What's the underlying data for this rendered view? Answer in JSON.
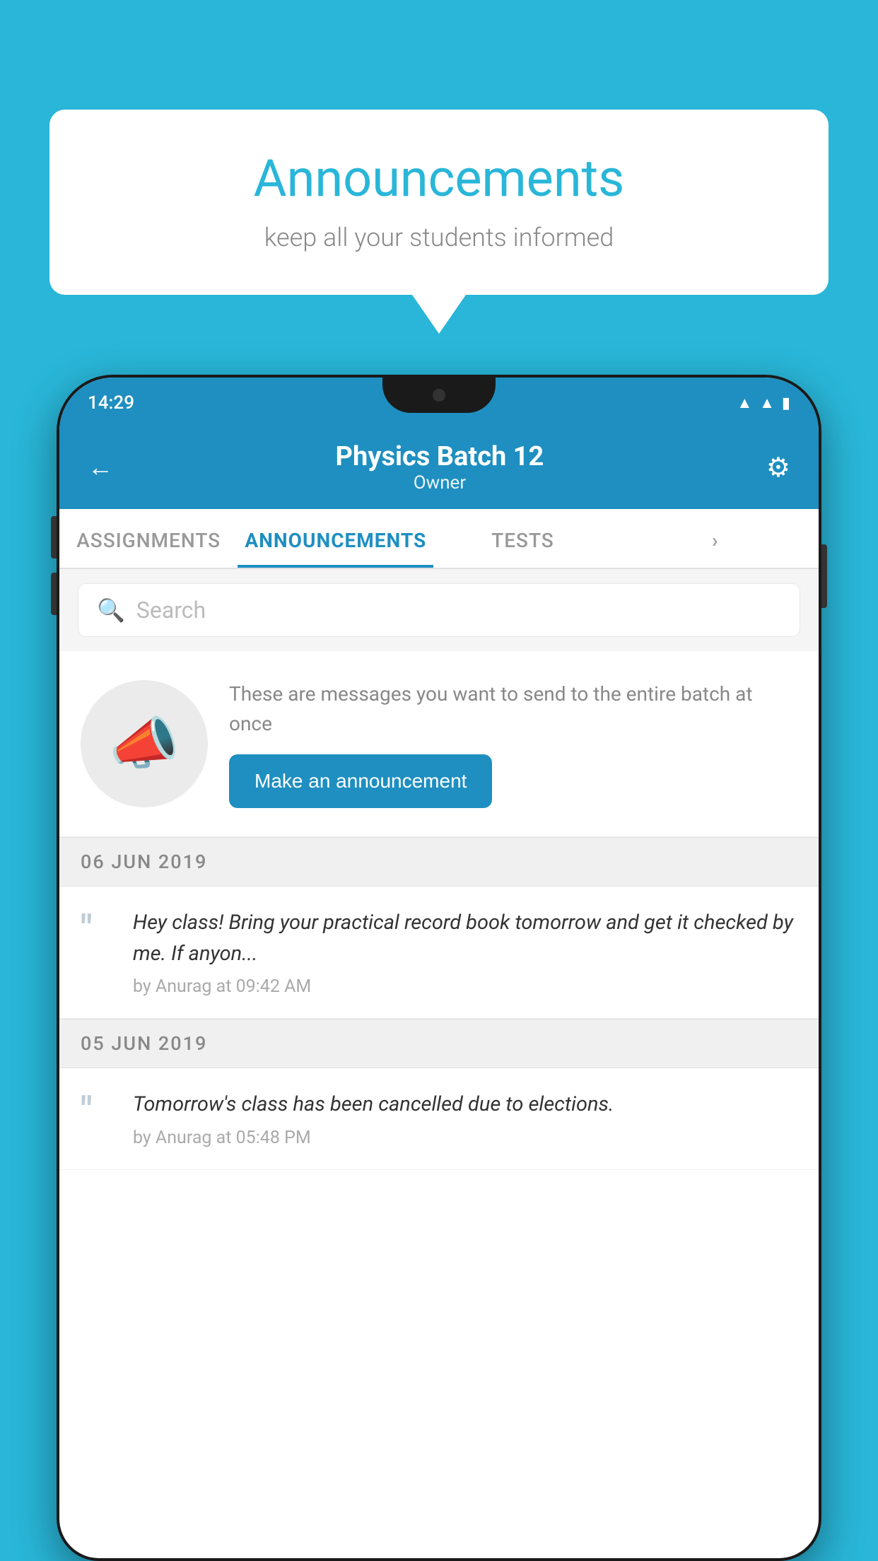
{
  "page": {
    "background_color": "#29b6d8"
  },
  "speech_bubble": {
    "title": "Announcements",
    "subtitle": "keep all your students informed"
  },
  "phone": {
    "status_bar": {
      "time": "14:29"
    },
    "header": {
      "back_label": "←",
      "title": "Physics Batch 12",
      "subtitle": "Owner",
      "settings_label": "⚙"
    },
    "tabs": [
      {
        "label": "ASSIGNMENTS",
        "active": false
      },
      {
        "label": "ANNOUNCEMENTS",
        "active": true
      },
      {
        "label": "TESTS",
        "active": false
      },
      {
        "label": "›",
        "active": false
      }
    ],
    "search": {
      "placeholder": "Search"
    },
    "announcement_prompt": {
      "description": "These are messages you want to send to the entire batch at once",
      "button_label": "Make an announcement"
    },
    "announcements": [
      {
        "date": "06  JUN  2019",
        "message": "Hey class! Bring your practical record book tomorrow and get it checked by me. If anyon...",
        "meta": "by Anurag at 09:42 AM"
      },
      {
        "date": "05  JUN  2019",
        "message": "Tomorrow's class has been cancelled due to elections.",
        "meta": "by Anurag at 05:48 PM"
      }
    ]
  }
}
